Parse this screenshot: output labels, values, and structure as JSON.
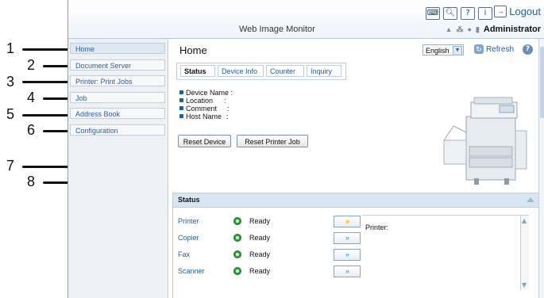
{
  "header": {
    "app_title": "Web Image Monitor",
    "logout_label": "Logout",
    "user_label": "Administrator",
    "icons": [
      "keyboard-icon",
      "search-icon",
      "help-icon",
      "info-icon",
      "logout-icon"
    ]
  },
  "sidebar": {
    "items": [
      {
        "label": "Home"
      },
      {
        "label": "Document Server"
      },
      {
        "label": "Printer: Print Jobs"
      },
      {
        "label": "Job"
      },
      {
        "label": "Address Book"
      },
      {
        "label": "Configuration"
      }
    ]
  },
  "main": {
    "title": "Home",
    "language": "English",
    "refresh_label": "Refresh",
    "tabs": [
      {
        "label": "Status"
      },
      {
        "label": "Device Info"
      },
      {
        "label": "Counter"
      },
      {
        "label": "Inquiry"
      }
    ],
    "info_rows": [
      {
        "label": "Device Name :"
      },
      {
        "label": "Location"
      },
      {
        "label": "Comment"
      },
      {
        "label": "Host Name"
      }
    ],
    "buttons": {
      "reset_device": "Reset Device",
      "reset_printer_job": "Reset Printer Job"
    }
  },
  "status": {
    "heading": "Status",
    "devices": [
      {
        "name": "Printer",
        "state": "Ready"
      },
      {
        "name": "Copier",
        "state": "Ready"
      },
      {
        "name": "Fax",
        "state": "Ready"
      },
      {
        "name": "Scanner",
        "state": "Ready"
      }
    ],
    "printer_detail_label": "Printer:"
  },
  "callouts": [
    "1",
    "2",
    "3",
    "4",
    "5",
    "6",
    "7",
    "8"
  ],
  "colors": {
    "link": "#2a5d94",
    "status_header": "#d8e6f3",
    "ready_green": "#3aa84a"
  }
}
